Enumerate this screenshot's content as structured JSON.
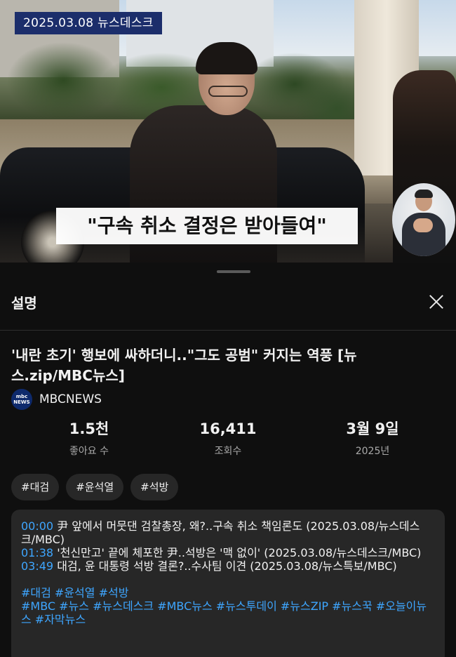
{
  "video": {
    "date_tag": "2025.03.08 뉴스데스크",
    "caption": "\"구속 취소 결정은 받아들여\""
  },
  "sheet": {
    "title": "설명",
    "video_title": "'내란 초기' 행보에 싸하더니..\"그도 공범\" 커지는 역풍 [뉴스.zip/MBC뉴스]",
    "channel": {
      "name": "MBCNEWS",
      "logo_text_top": "mbc",
      "logo_text_bottom": "NEWS"
    },
    "stats": [
      {
        "value": "1.5천",
        "label": "좋아요 수"
      },
      {
        "value": "16,411",
        "label": "조회수"
      },
      {
        "value": "3월 9일",
        "label": "2025년"
      }
    ],
    "chips": [
      "#대검",
      "#윤석열",
      "#석방"
    ],
    "description": {
      "chapters": [
        {
          "time": "00:00",
          "text": " 尹 앞에서 머뭇댄 검찰총장, 왜?..구속 취소 책임론도 (2025.03.08/뉴스데스크/MBC)"
        },
        {
          "time": "01:38",
          "text": " '천신만고' 끝에 체포한 尹..석방은 '맥 없이' (2025.03.08/뉴스데스크/MBC)"
        },
        {
          "time": "03:49",
          "text": " 대검, 윤 대통령 석방 결론?..수사팀 이견 (2025.03.08/뉴스특보/MBC)"
        }
      ],
      "hashtags_line1": "#대검 #윤석열 #석방",
      "hashtags_line2": "#MBC #뉴스 #뉴스데스크 #MBC뉴스 #뉴스투데이 #뉴스ZIP #뉴스꾹 #오늘이뉴스 #자막뉴스"
    }
  },
  "colors": {
    "background": "#0f0f0f",
    "card": "#272727",
    "link": "#3ea6ff",
    "date_tag": "#1c2e6b"
  }
}
